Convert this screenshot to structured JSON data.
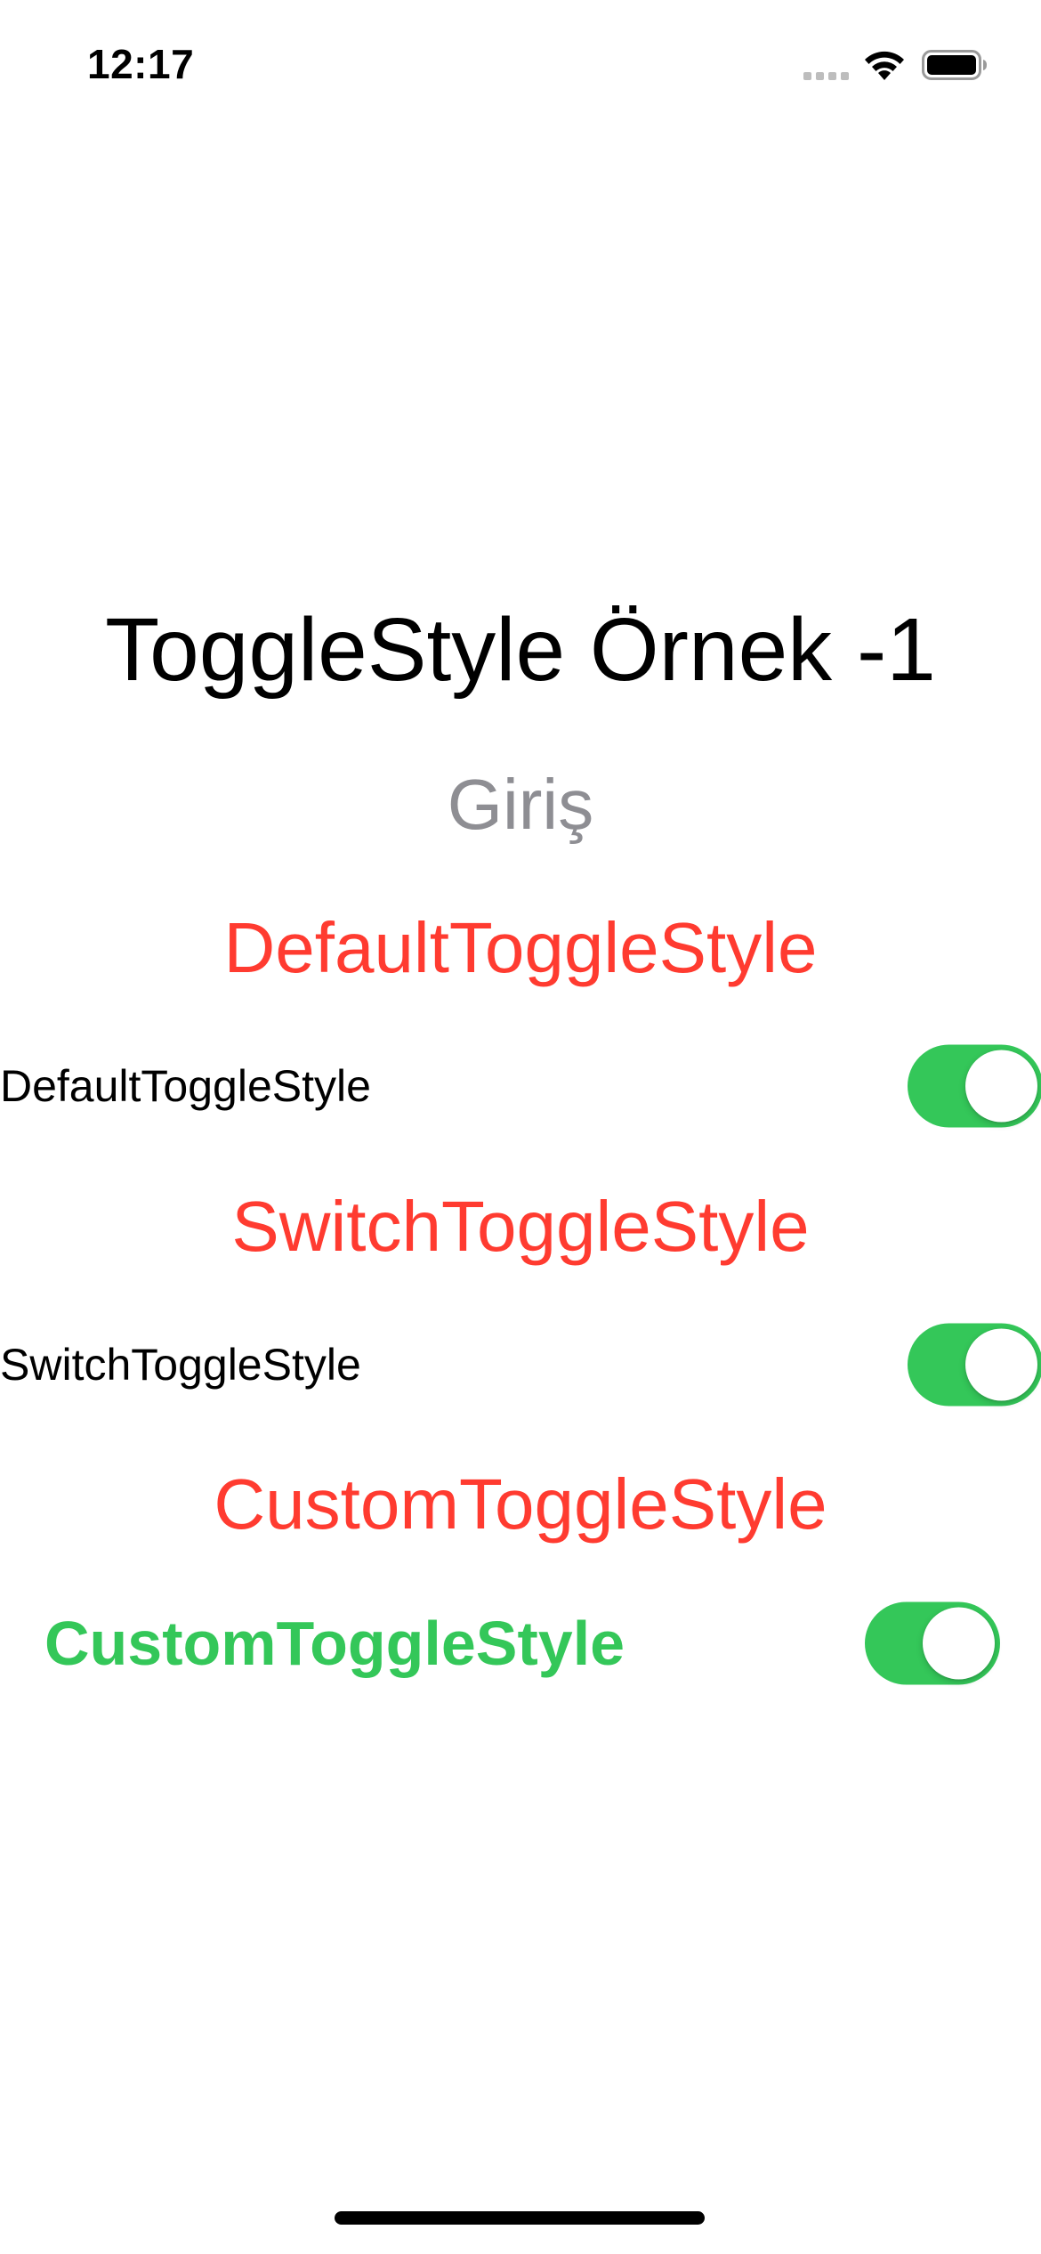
{
  "status_bar": {
    "time": "12:17",
    "icons": [
      "cellular-signal-icon",
      "wifi-icon",
      "battery-icon"
    ]
  },
  "screen": {
    "title": "ToggleStyle Örnek -1",
    "subtitle": "Giriş",
    "sections": [
      {
        "heading": "DefaultToggleStyle",
        "toggle_label": "DefaultToggleStyle",
        "toggle_on": true
      },
      {
        "heading": "SwitchToggleStyle",
        "toggle_label": "SwitchToggleStyle",
        "toggle_on": true
      },
      {
        "heading": "CustomToggleStyle",
        "toggle_label": "CustomToggleStyle",
        "toggle_on": true
      }
    ]
  },
  "colors": {
    "heading": "#ff3b30",
    "subtitle": "#8e8e93",
    "toggle_on": "#34c759",
    "custom_label": "#34c759"
  }
}
